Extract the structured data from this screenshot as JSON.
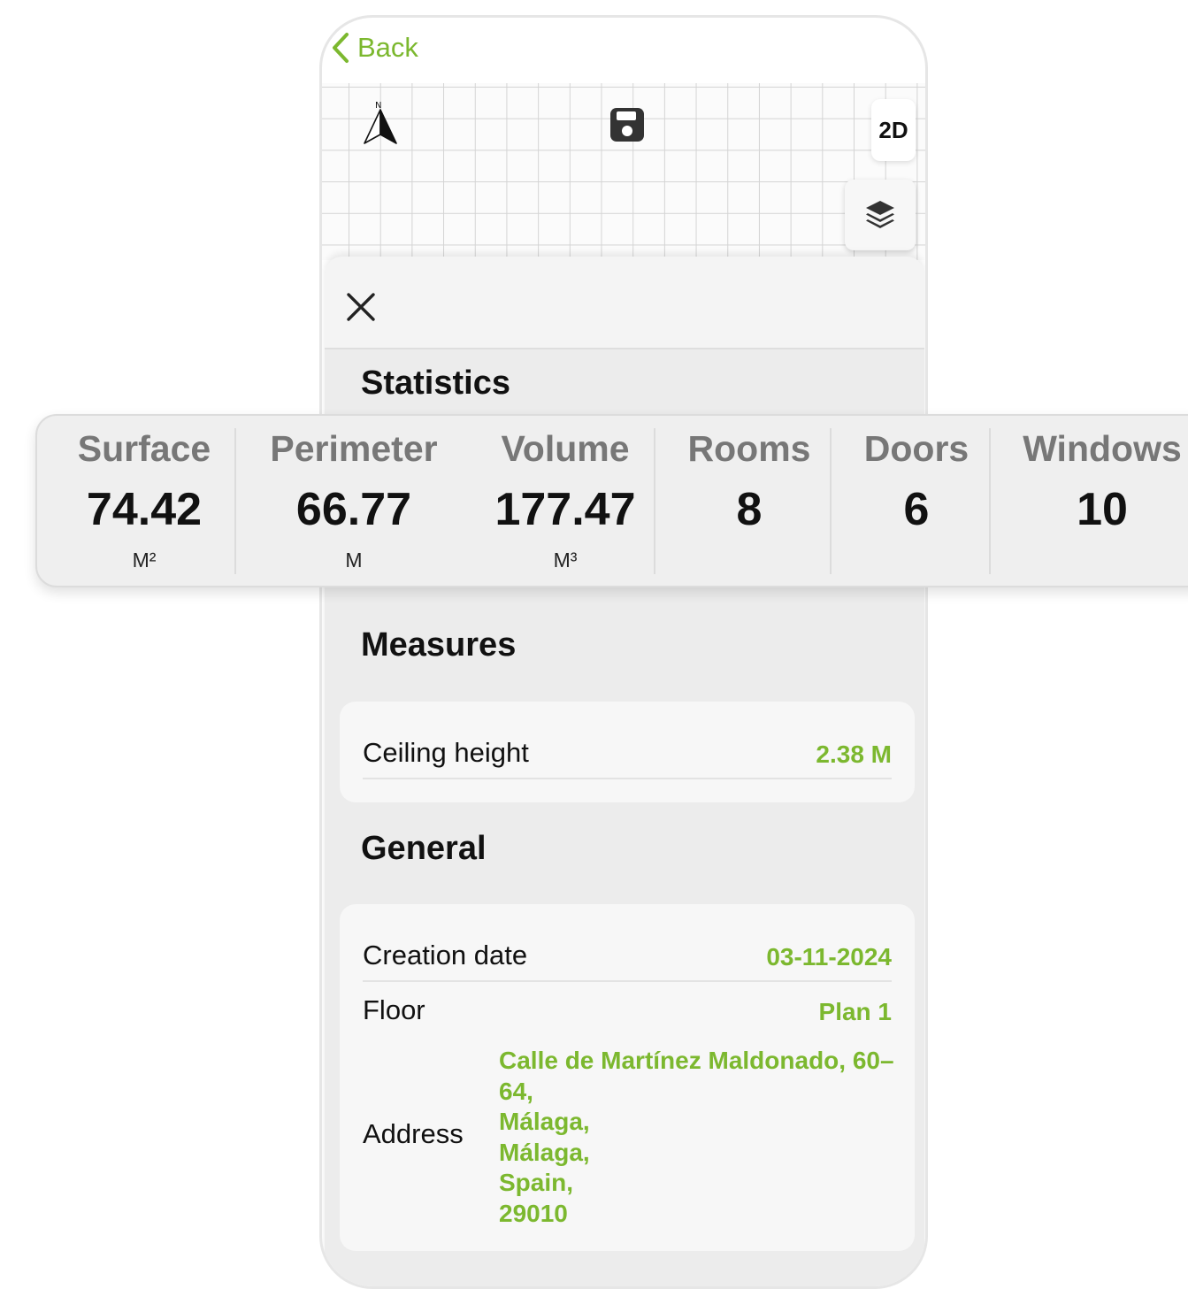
{
  "nav": {
    "back_label": "Back"
  },
  "map": {
    "compass_letter": "N",
    "view_mode_label": "2D"
  },
  "icons": {
    "back": "chevron-left-icon",
    "compass": "compass-north-icon",
    "save": "floppy-disk-icon",
    "layers": "layers-icon",
    "close": "close-icon"
  },
  "sections": {
    "statistics": "Statistics",
    "measures": "Measures",
    "general": "General"
  },
  "statistics": [
    {
      "name": "Surface",
      "value": "74.42",
      "unit": "M²"
    },
    {
      "name": "Perimeter",
      "value": "66.77",
      "unit": "M"
    },
    {
      "name": "Volume",
      "value": "177.47",
      "unit": "M³"
    },
    {
      "name": "Rooms",
      "value": "8",
      "unit": ""
    },
    {
      "name": "Doors",
      "value": "6",
      "unit": ""
    },
    {
      "name": "Windows",
      "value": "10",
      "unit": ""
    }
  ],
  "measures": {
    "ceiling_height_label": "Ceiling height",
    "ceiling_height_value": "2.38 M"
  },
  "general": {
    "creation_date_label": "Creation date",
    "creation_date_value": "03-11-2024",
    "floor_label": "Floor",
    "floor_value": "Plan 1",
    "address_label": "Address",
    "address_lines": [
      "Calle de Martínez Maldonado, 60–",
      "64,",
      "Málaga,",
      "Málaga,",
      "Spain,",
      "29010"
    ]
  },
  "colors": {
    "accent": "#7cb82f",
    "sheet_bg": "#ececec",
    "card_bg": "#f7f7f7",
    "stat_label": "#777777"
  }
}
